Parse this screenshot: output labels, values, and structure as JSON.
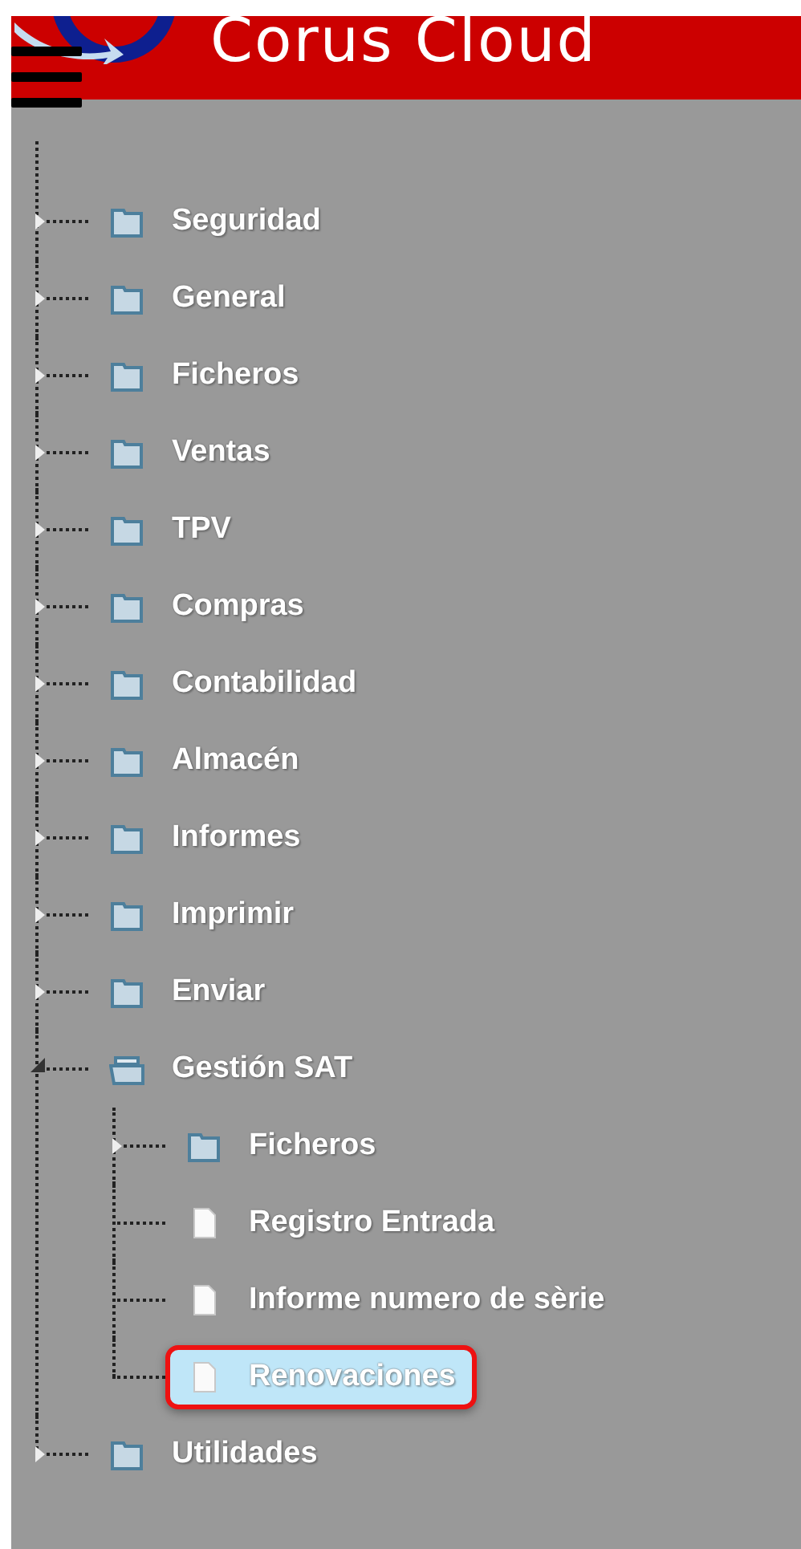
{
  "header": {
    "title": "Corus Cloud"
  },
  "tree": [
    {
      "label": "Seguridad",
      "kind": "folder",
      "expanded": false,
      "selected": false
    },
    {
      "label": "General",
      "kind": "folder",
      "expanded": false,
      "selected": false
    },
    {
      "label": "Ficheros",
      "kind": "folder",
      "expanded": false,
      "selected": false
    },
    {
      "label": "Ventas",
      "kind": "folder",
      "expanded": false,
      "selected": false
    },
    {
      "label": "TPV",
      "kind": "folder",
      "expanded": false,
      "selected": false
    },
    {
      "label": "Compras",
      "kind": "folder",
      "expanded": false,
      "selected": false
    },
    {
      "label": "Contabilidad",
      "kind": "folder",
      "expanded": false,
      "selected": false
    },
    {
      "label": "Almacén",
      "kind": "folder",
      "expanded": false,
      "selected": false
    },
    {
      "label": "Informes",
      "kind": "folder",
      "expanded": false,
      "selected": false
    },
    {
      "label": "Imprimir",
      "kind": "folder",
      "expanded": false,
      "selected": false
    },
    {
      "label": "Enviar",
      "kind": "folder",
      "expanded": false,
      "selected": false
    },
    {
      "label": "Gestión SAT",
      "kind": "folder",
      "expanded": true,
      "selected": false,
      "children": [
        {
          "label": "Ficheros",
          "kind": "folder",
          "expanded": false,
          "selected": false
        },
        {
          "label": "Registro Entrada",
          "kind": "page",
          "selected": false
        },
        {
          "label": "Informe numero de sèrie",
          "kind": "page",
          "selected": false
        },
        {
          "label": "Renovaciones",
          "kind": "page",
          "selected": true
        }
      ]
    },
    {
      "label": "Utilidades",
      "kind": "folder",
      "expanded": false,
      "selected": false
    }
  ]
}
